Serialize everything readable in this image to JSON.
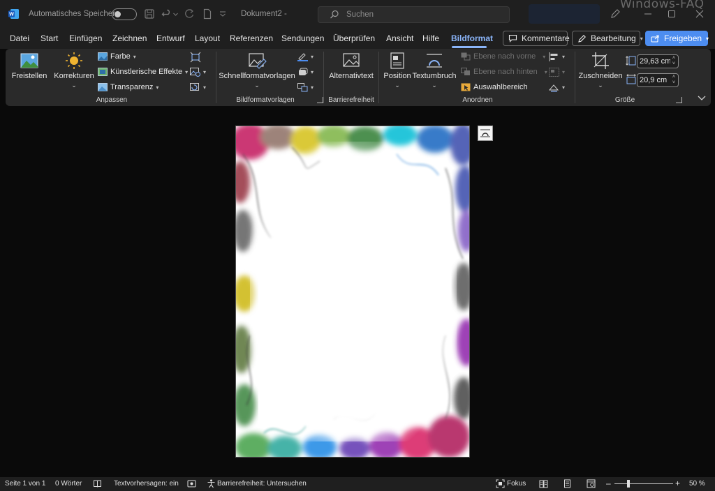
{
  "titlebar": {
    "autosave_label": "Automatisches Speichern",
    "document_name": "Dokument2  -",
    "search_placeholder": "Suchen",
    "watermark": "Windows-FAQ"
  },
  "tabs": [
    {
      "label": "Datei"
    },
    {
      "label": "Start"
    },
    {
      "label": "Einfügen"
    },
    {
      "label": "Zeichnen"
    },
    {
      "label": "Entwurf"
    },
    {
      "label": "Layout"
    },
    {
      "label": "Referenzen"
    },
    {
      "label": "Sendungen"
    },
    {
      "label": "Überprüfen"
    },
    {
      "label": "Ansicht"
    },
    {
      "label": "Hilfe"
    },
    {
      "label": "Bildformat"
    }
  ],
  "active_tab": "Bildformat",
  "header_buttons": {
    "comments": "Kommentare",
    "editing": "Bearbeitung",
    "share": "Freigeben"
  },
  "ribbon": {
    "anpassen": {
      "group_label": "Anpassen",
      "freistellen": "Freistellen",
      "korrekturen": "Korrekturen",
      "farbe": "Farbe",
      "kuenstlerische_effekte": "Künstlerische Effekte",
      "transparenz": "Transparenz"
    },
    "bildformatvorlagen": {
      "group_label": "Bildformatvorlagen",
      "schnellformatvorlagen": "Schnellformatvorlagen"
    },
    "barrierefreiheit": {
      "group_label": "Barrierefreiheit",
      "alternativtext": "Alternativtext"
    },
    "anordnen": {
      "group_label": "Anordnen",
      "position": "Position",
      "textumbruch": "Textumbruch",
      "ebene_vorne": "Ebene nach vorne",
      "ebene_hinten": "Ebene nach hinten",
      "auswahlbereich": "Auswahlbereich"
    },
    "groesse": {
      "group_label": "Größe",
      "zuschneiden": "Zuschneiden",
      "hoehe": "29,63 cm",
      "breite": "20,9 cm"
    }
  },
  "statusbar": {
    "page": "Seite 1 von 1",
    "words": "0 Wörter",
    "text_predictions": "Textvorhersagen: ein",
    "accessibility": "Barrierefreiheit: Untersuchen",
    "focus": "Fokus",
    "zoom_level": "50 %",
    "zoom_minus": "–",
    "zoom_plus": "+"
  },
  "colors": {
    "accent": "#8ab4f8",
    "share_button": "#4d8df0",
    "ribbon_bg": "#2a2a2a",
    "titlebar_bg": "#1f1f1f",
    "canvas_bg": "#0a0a0a"
  }
}
